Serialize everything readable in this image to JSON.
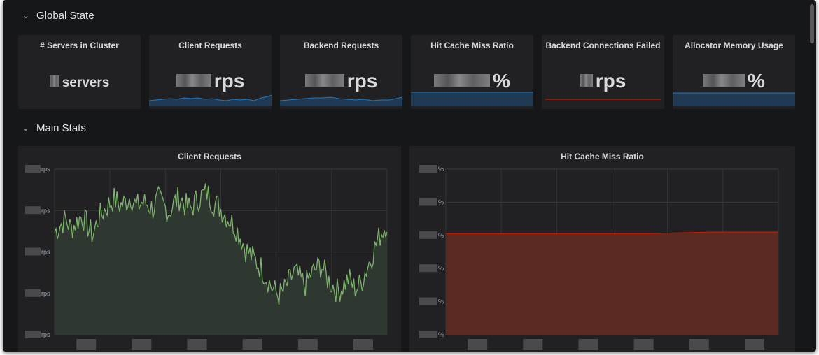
{
  "rows": {
    "global": "Global State",
    "main": "Main Stats"
  },
  "stats": [
    {
      "title": "# Servers in Cluster",
      "unit": "servers",
      "sparkline": false,
      "spark_color": null
    },
    {
      "title": "Client Requests",
      "unit": "rps",
      "sparkline": true,
      "spark_color": "#1f78c1"
    },
    {
      "title": "Backend Requests",
      "unit": "rps",
      "sparkline": true,
      "spark_color": "#1f78c1"
    },
    {
      "title": "Hit Cache Miss Ratio",
      "unit": "%",
      "sparkline": true,
      "spark_color": "#1f78c1"
    },
    {
      "title": "Backend Connections Failed",
      "unit": "rps",
      "sparkline": true,
      "spark_color": "#bf1b00"
    },
    {
      "title": "Allocator Memory Usage",
      "unit": "%",
      "sparkline": true,
      "spark_color": "#1f78c1"
    }
  ],
  "panels": {
    "client_requests": {
      "title": "Client Requests",
      "y_unit": "rps",
      "line_color": "#7eb26d",
      "fill_color": "#2f3830"
    },
    "hit_cache": {
      "title": "Hit Cache Miss Ratio",
      "y_unit": "%",
      "line_color": "#bf1b00",
      "fill_color": "#5b2a21"
    }
  },
  "chart_data": [
    {
      "type": "area",
      "title": "Client Requests",
      "ylabel": "rps",
      "series": [
        {
          "values": [
            0.62,
            0.66,
            0.7,
            0.64,
            0.68,
            0.72,
            0.66,
            0.6,
            0.7,
            0.75,
            0.79,
            0.82,
            0.78,
            0.8,
            0.84,
            0.77,
            0.8,
            0.79,
            0.76,
            0.82,
            0.78,
            0.74,
            0.8,
            0.83,
            0.78,
            0.76,
            0.81,
            0.84,
            0.86,
            0.8,
            0.78,
            0.74,
            0.7,
            0.66,
            0.6,
            0.52,
            0.48,
            0.44,
            0.4,
            0.34,
            0.28,
            0.24,
            0.26,
            0.32,
            0.38,
            0.34,
            0.3,
            0.36,
            0.4,
            0.42,
            0.34,
            0.3,
            0.26,
            0.3,
            0.34,
            0.28,
            0.3,
            0.38,
            0.46,
            0.55,
            0.62,
            0.68
          ]
        }
      ]
    },
    {
      "type": "area",
      "title": "Hit Cache Miss Ratio",
      "ylabel": "%",
      "series": [
        {
          "values": [
            0.61,
            0.61,
            0.61,
            0.61,
            0.62,
            0.62
          ]
        }
      ]
    }
  ]
}
